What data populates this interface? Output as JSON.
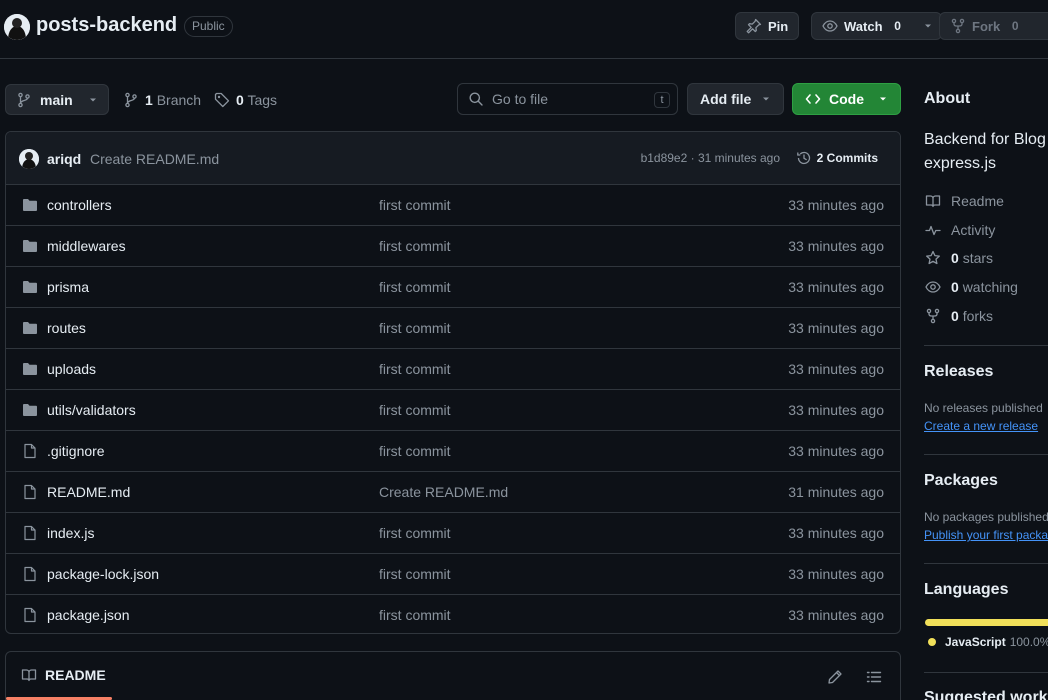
{
  "header": {
    "repo_name": "posts-backend",
    "visibility": "Public",
    "pin_label": "Pin",
    "watch_label": "Watch",
    "watch_count": "0",
    "fork_label": "Fork",
    "fork_count": "0"
  },
  "toolbar": {
    "branch": "main",
    "branch_count": "1",
    "branch_label": "Branch",
    "tag_count": "0",
    "tag_label": "Tags",
    "goto_placeholder": "Go to file",
    "goto_shortcut": "t",
    "add_file_label": "Add file",
    "code_label": "Code"
  },
  "latest_commit": {
    "author": "ariqd",
    "message": "Create README.md",
    "hash_time": "b1d89e2 · 31 minutes ago",
    "commits_label": "2 Commits"
  },
  "files": [
    {
      "name": "controllers",
      "type": "folder",
      "message": "first commit",
      "time": "33 minutes ago"
    },
    {
      "name": "middlewares",
      "type": "folder",
      "message": "first commit",
      "time": "33 minutes ago"
    },
    {
      "name": "prisma",
      "type": "folder",
      "message": "first commit",
      "time": "33 minutes ago"
    },
    {
      "name": "routes",
      "type": "folder",
      "message": "first commit",
      "time": "33 minutes ago"
    },
    {
      "name": "uploads",
      "type": "folder",
      "message": "first commit",
      "time": "33 minutes ago"
    },
    {
      "name": "utils/validators",
      "type": "folder",
      "message": "first commit",
      "time": "33 minutes ago"
    },
    {
      "name": ".gitignore",
      "type": "file",
      "message": "first commit",
      "time": "33 minutes ago"
    },
    {
      "name": "README.md",
      "type": "file",
      "message": "Create README.md",
      "time": "31 minutes ago"
    },
    {
      "name": "index.js",
      "type": "file",
      "message": "first commit",
      "time": "33 minutes ago"
    },
    {
      "name": "package-lock.json",
      "type": "file",
      "message": "first commit",
      "time": "33 minutes ago"
    },
    {
      "name": "package.json",
      "type": "file",
      "message": "first commit",
      "time": "33 minutes ago"
    }
  ],
  "readme": {
    "tab_label": "README"
  },
  "sidebar": {
    "about_title": "About",
    "description_line1": "Backend for Blog",
    "description_line2": "express.js",
    "readme": "Readme",
    "activity": "Activity",
    "stars_count": "0",
    "stars_label": "stars",
    "watching_count": "0",
    "watching_label": "watching",
    "forks_count": "0",
    "forks_label": "forks",
    "releases_title": "Releases",
    "releases_empty": "No releases published",
    "releases_link": "Create a new release",
    "packages_title": "Packages",
    "packages_empty": "No packages published",
    "packages_link": "Publish your first package",
    "languages_title": "Languages",
    "language_name": "JavaScript",
    "language_percent": "100.0%",
    "suggested_title": "Suggested workflows"
  },
  "colors": {
    "background": "#0d1117",
    "border": "#30363d",
    "code_button": "#238636",
    "link": "#4493f8",
    "javascript": "#f1e05a",
    "readme_underline": "#f78166"
  }
}
